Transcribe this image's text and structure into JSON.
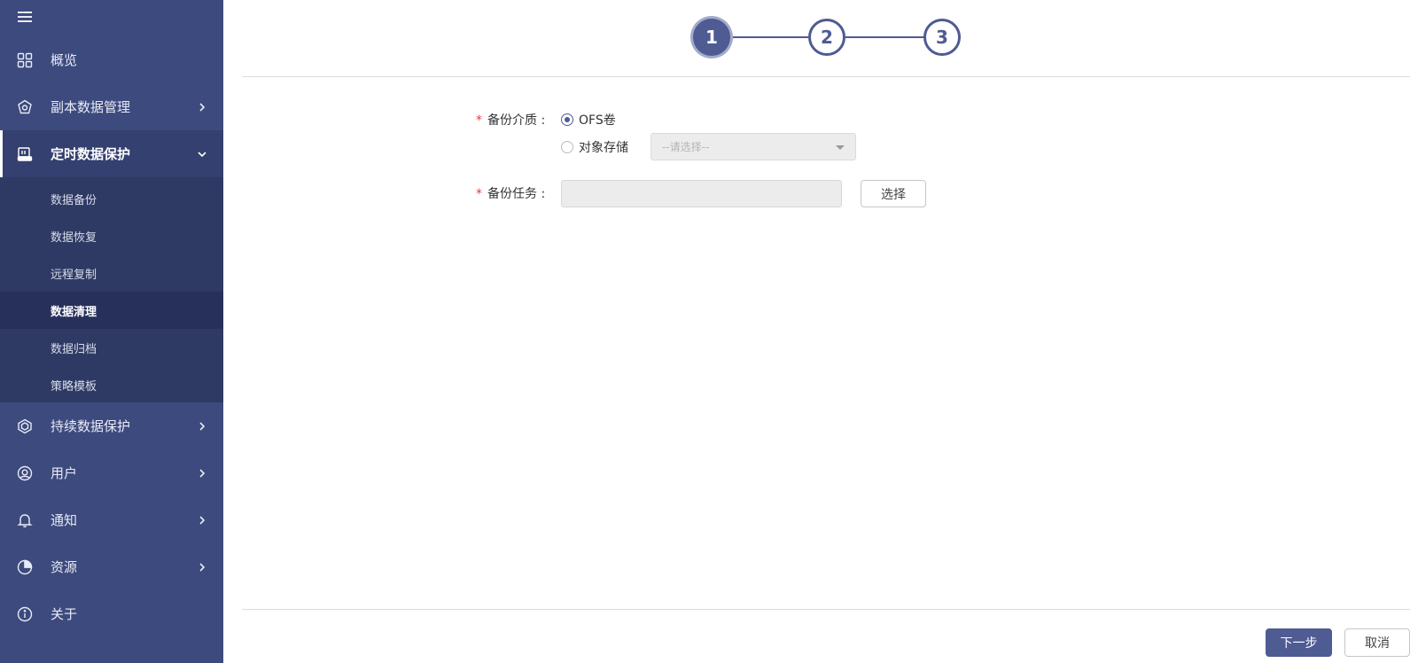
{
  "sidebar": {
    "items": [
      {
        "label": "概览",
        "icon": "grid-icon"
      },
      {
        "label": "副本数据管理",
        "icon": "replica-icon"
      },
      {
        "label": "定时数据保护",
        "icon": "schedule-disk-icon"
      },
      {
        "label": "持续数据保护",
        "icon": "continuous-icon"
      },
      {
        "label": "用户",
        "icon": "user-icon"
      },
      {
        "label": "通知",
        "icon": "bell-icon"
      },
      {
        "label": "资源",
        "icon": "pie-icon"
      },
      {
        "label": "关于",
        "icon": "info-icon"
      }
    ],
    "submenu": [
      "数据备份",
      "数据恢复",
      "远程复制",
      "数据清理",
      "数据归档",
      "策略模板"
    ],
    "current_submenu": "数据清理"
  },
  "stepper": {
    "steps": [
      "1",
      "2",
      "3"
    ],
    "active_step": 1
  },
  "form": {
    "media_label": "备份介质 :",
    "required_mark": "*",
    "option_ofs": "OFS卷",
    "option_object": "对象存储",
    "selected_option": "OFS卷",
    "object_select_placeholder": "--请选择--",
    "task_label": "备份任务 :",
    "task_value": "",
    "select_button": "选择"
  },
  "footer": {
    "next_button": "下一步",
    "cancel_button": "取消"
  },
  "colors": {
    "sidebar_bg": "#3d4a7e",
    "submenu_bg": "#2f3a64",
    "accent": "#4f5b93"
  }
}
